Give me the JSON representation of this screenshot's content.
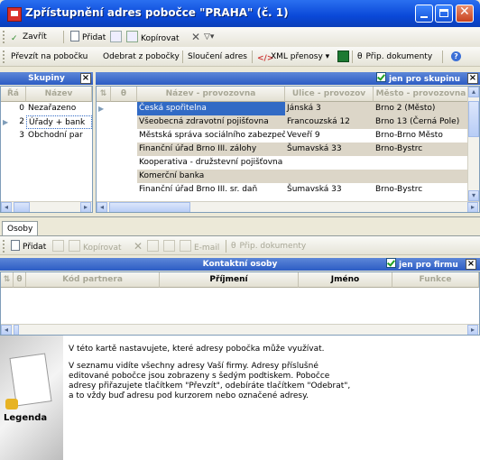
{
  "window": {
    "title": "Zpřístupnění adres pobočce \"PRAHA\" (č. 1)"
  },
  "toolbar1": {
    "close": "Zavřít",
    "add": "Přidat",
    "copy": "Kopírovat"
  },
  "toolbar2": {
    "assign": "Převzít na pobočku",
    "remove": "Odebrat z pobočky",
    "merge": "Sloučení adres",
    "xml": "XML přenosy",
    "docs": "Přip. dokumenty"
  },
  "groups_panel": {
    "title": "Skupiny",
    "col_rank": "Řá",
    "col_name": "Název",
    "rows": [
      {
        "num": "0",
        "name": "Nezařazeno"
      },
      {
        "num": "2",
        "name": "Úřady + bank"
      },
      {
        "num": "3",
        "name": "Obchodní par"
      }
    ]
  },
  "addresses_panel": {
    "only_group": "jen pro skupinu",
    "columns": [
      "Název - provozovna",
      "Ulice - provozov",
      "Město - provozovna"
    ],
    "rows": [
      {
        "name": "Česká spořitelna",
        "street": "Jánská 3",
        "city": "Brno 2 (Město)"
      },
      {
        "name": "Všeobecná zdravotní pojišťovna",
        "street": "Francouzská 12",
        "city": "Brno 13 (Černá Pole)"
      },
      {
        "name": "Městská správa sociálního zabezpečení",
        "street": "Veveří 9",
        "city": "Brno-Brno Město"
      },
      {
        "name": "Finanční úřad Brno III. zálohy",
        "street": "Šumavská 33",
        "city": "Brno-Bystrc"
      },
      {
        "name": "Kooperativa - družstevní pojišťovna",
        "street": "",
        "city": ""
      },
      {
        "name": "Komerční banka",
        "street": "",
        "city": ""
      },
      {
        "name": "Finanční úřad Brno III. sr. daň",
        "street": "Šumavská 33",
        "city": "Brno-Bystrc"
      }
    ]
  },
  "persons_tab": {
    "tab_label": "Osoby",
    "add": "Přidat",
    "copy": "Kopírovat",
    "email": "E-mail",
    "docs": "Přip. dokumenty",
    "title": "Kontaktní osoby",
    "only_firm": "jen pro firmu",
    "columns": [
      "Kód partnera",
      "Příjmení",
      "Jméno",
      "Funkce"
    ]
  },
  "legend": {
    "label": "Legenda",
    "p1": "V této kartě nastavujete, které adresy pobočka může využívat.",
    "p2_line1": "V seznamu vidíte všechny adresy Vaší firmy. Adresy příslušné",
    "p2_line2": "editované pobočce jsou zobrazeny s šedým podtiskem. Pobočce",
    "p2_line3": "adresy přiřazujete tlačítkem \"Převzít\", odebíráte tlačítkem \"Odebrat\",",
    "p2_line4": "a to vždy buď adresu pod kurzorem nebo označené adresy."
  },
  "colors": {
    "selection": "#316ac5",
    "assigned_row": "#dcd6c8",
    "header_blue": "#2c5cc4"
  }
}
